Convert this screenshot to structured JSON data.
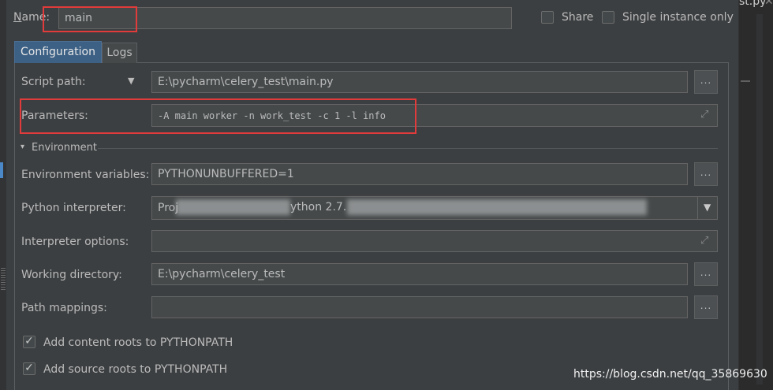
{
  "header": {
    "name_label_mnemonic": "N",
    "name_label_rest": "ame:",
    "name_value": "main",
    "share_label": "Share",
    "single_instance_label": "Single instance only"
  },
  "tabs": [
    {
      "label": "Configuration",
      "active": true
    },
    {
      "label": "Logs",
      "active": false
    }
  ],
  "form": {
    "script_path_label": "Script path:",
    "script_path_value": "E:\\pycharm\\celery_test\\main.py",
    "parameters_label": "Parameters:",
    "parameters_value": "-A main worker -n work_test -c 1 -l info",
    "environment_section": "Environment",
    "env_vars_label": "Environment variables:",
    "env_vars_value": "PYTHONUNBUFFERED=1",
    "interpreter_label": "Python interpreter:",
    "interpreter_value_start": "Proj",
    "interpreter_value_mid": "ython 2.7.",
    "interpreter_options_label": "Interpreter options:",
    "interpreter_options_value": "",
    "working_dir_label": "Working directory:",
    "working_dir_value": "E:\\pycharm\\celery_test",
    "path_mappings_label": "Path mappings:",
    "path_mappings_value": "",
    "add_content_roots_label": "Add content roots to PYTHONPATH",
    "add_source_roots_label": "Add source roots to PYTHONPATH",
    "browse_label": "...",
    "expand_glyph": "⤢",
    "dropdown_glyph": "▼",
    "section_toggle_glyph": "▾"
  },
  "editor_tab": {
    "label": "st.py",
    "close": "✕"
  },
  "watermark": "https://blog.csdn.net/qq_35869630",
  "colors": {
    "highlight_box": "#e23b3b",
    "active_tab": "#3d6185"
  }
}
